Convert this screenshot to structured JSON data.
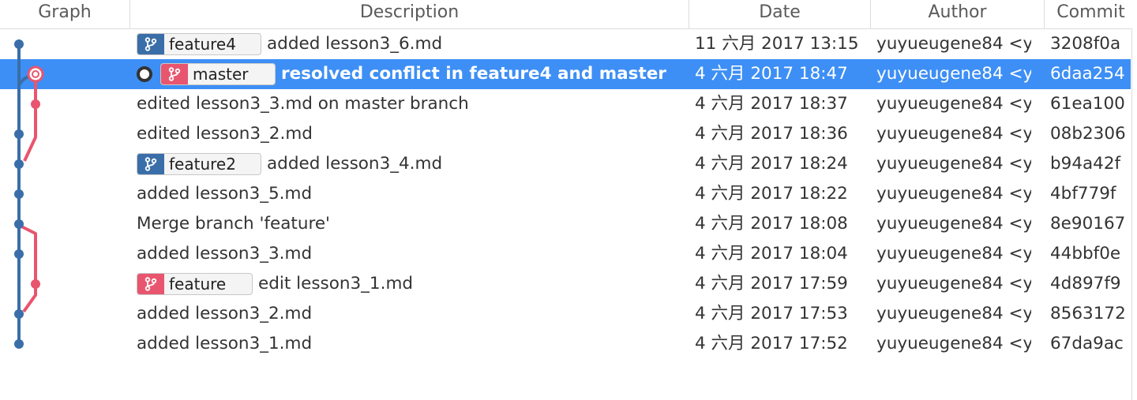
{
  "columns": {
    "graph": "Graph",
    "description": "Description",
    "date": "Date",
    "author": "Author",
    "commit": "Commit"
  },
  "colors": {
    "selection": "#3d8ff5",
    "blue_branch": "#3a6ea8",
    "red_branch": "#e8556e"
  },
  "commits": [
    {
      "badge": "feature4",
      "badge_color": "blue",
      "message": "added lesson3_6.md",
      "date": "11 六月 2017 13:15",
      "author": "yuyueugene84 <y",
      "commit": "3208f0a"
    },
    {
      "badge": "master",
      "badge_color": "red",
      "head": true,
      "selected": true,
      "message": "resolved conflict in feature4 and master",
      "date": "4 六月 2017 18:47",
      "author": "yuyueugene84 <y",
      "commit": "6daa254"
    },
    {
      "message": "edited lesson3_3.md on master branch",
      "date": "4 六月 2017 18:37",
      "author": "yuyueugene84 <y",
      "commit": "61ea100"
    },
    {
      "message": "edited lesson3_2.md",
      "date": "4 六月 2017 18:36",
      "author": "yuyueugene84 <y",
      "commit": "08b2306"
    },
    {
      "badge": "feature2",
      "badge_color": "blue",
      "message": "added lesson3_4.md",
      "date": "4 六月 2017 18:24",
      "author": "yuyueugene84 <y",
      "commit": "b94a42f"
    },
    {
      "message": "added lesson3_5.md",
      "date": "4 六月 2017 18:22",
      "author": "yuyueugene84 <y",
      "commit": "4bf779f"
    },
    {
      "message": "Merge branch 'feature'",
      "date": "4 六月 2017 18:08",
      "author": "yuyueugene84 <y",
      "commit": "8e90167"
    },
    {
      "message": "added lesson3_3.md",
      "date": "4 六月 2017 18:04",
      "author": "yuyueugene84 <y",
      "commit": "44bbf0e"
    },
    {
      "badge": "feature",
      "badge_color": "red",
      "message": "edit lesson3_1.md",
      "date": "4 六月 2017 17:59",
      "author": "yuyueugene84 <y",
      "commit": "4d897f9"
    },
    {
      "message": "added lesson3_2.md",
      "date": "4 六月 2017 17:53",
      "author": "yuyueugene84 <y",
      "commit": "8563172"
    },
    {
      "message": "added lesson3_1.md",
      "date": "4 六月 2017 17:52",
      "author": "yuyueugene84 <y",
      "commit": "67da9ac"
    }
  ]
}
